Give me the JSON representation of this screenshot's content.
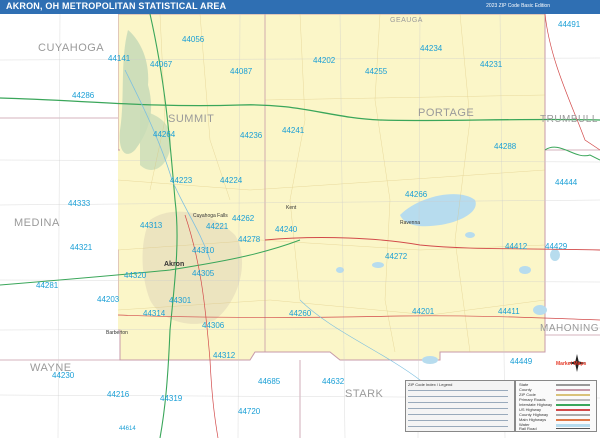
{
  "title": "AKRON, OH METROPOLITAN STATISTICAL AREA",
  "edition": "2023 ZIP Code Basic Edition",
  "logo": "Market Maps",
  "counties": [
    {
      "name": "CUYAHOGA"
    },
    {
      "name": "GEAUGA"
    },
    {
      "name": "SUMMIT"
    },
    {
      "name": "PORTAGE"
    },
    {
      "name": "TRUMBULL"
    },
    {
      "name": "MEDINA"
    },
    {
      "name": "MAHONING"
    },
    {
      "name": "WAYNE"
    },
    {
      "name": "STARK"
    }
  ],
  "zips": [
    "44491",
    "44056",
    "44234",
    "44141",
    "44067",
    "44202",
    "44255",
    "44231",
    "44087",
    "44286",
    "44264",
    "44236",
    "44241",
    "44288",
    "44223",
    "44224",
    "44266",
    "44444",
    "44333",
    "44313",
    "44221",
    "44262",
    "44240",
    "44278",
    "44321",
    "44310",
    "44412",
    "44429",
    "44272",
    "44320",
    "44305",
    "44281",
    "44203",
    "44301",
    "44314",
    "44306",
    "44260",
    "44201",
    "44411",
    "44312",
    "44449",
    "44685",
    "44230",
    "44632",
    "44216",
    "44319",
    "44720",
    "44614"
  ],
  "cities": [
    "Akron",
    "Cuyahoga Falls",
    "Kent",
    "Barberton",
    "Ravenna"
  ],
  "legend": {
    "title": "ZIP Code Index / Legend",
    "items": [
      {
        "label": "State"
      },
      {
        "label": "County"
      },
      {
        "label": "ZIP Code"
      },
      {
        "label": "Primary Roads"
      },
      {
        "label": "Interstate Highway"
      },
      {
        "label": "US Highway"
      },
      {
        "label": "County Highway"
      },
      {
        "label": "Main Highways"
      },
      {
        "label": "Water"
      },
      {
        "label": "Rail Road"
      }
    ]
  },
  "colors": {
    "land": "#fbf6c8",
    "outside": "#ffffff",
    "water": "#b7dcee",
    "park": "#c9dcb8",
    "urban": "#e8e0bd",
    "zip_text": "#1a9fd6",
    "interstate": "#3aa65a",
    "highway": "#d24a4a",
    "county_text": "#9a9a9a",
    "title_bar": "#2f6fb3"
  }
}
